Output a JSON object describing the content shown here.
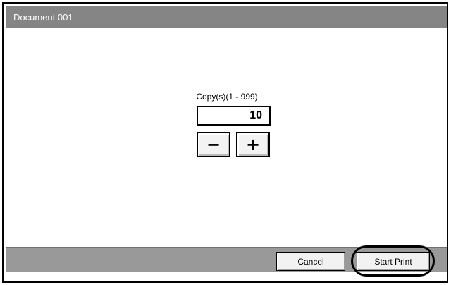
{
  "window": {
    "title": "Document 001"
  },
  "copies": {
    "label": "Copy(s)(1 - 999)",
    "value": "10"
  },
  "stepper": {
    "minus_label": "−",
    "plus_label": "+"
  },
  "actions": {
    "cancel_label": "Cancel",
    "start_print_label": "Start Print"
  },
  "colors": {
    "title_bar": "#858585",
    "bottom_bar": "#999999",
    "button_face": "#f2f2f2"
  },
  "icons": {
    "minus": "minus-icon",
    "plus": "plus-icon"
  }
}
